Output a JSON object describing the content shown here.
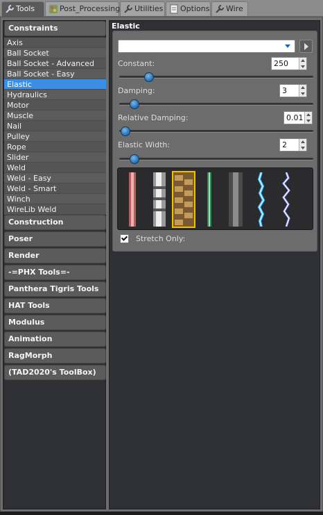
{
  "tabs": [
    {
      "label": "Tools",
      "icon": "wrench-icon",
      "active": true
    },
    {
      "label": "Post_Processing",
      "icon": "palette-icon",
      "active": false
    },
    {
      "label": "Utilities",
      "icon": "wrench-icon",
      "active": false
    },
    {
      "label": "Options",
      "icon": "document-icon",
      "active": false
    },
    {
      "label": "Wire",
      "icon": "wrench-icon",
      "active": false
    }
  ],
  "sidebar": {
    "open_category": "Constraints",
    "items": [
      "Axis",
      "Ball Socket",
      "Ball Socket - Advanced",
      "Ball Socket - Easy",
      "Elastic",
      "Hydraulics",
      "Motor",
      "Muscle",
      "Nail",
      "Pulley",
      "Rope",
      "Slider",
      "Weld",
      "Weld - Easy",
      "Weld - Smart",
      "Winch",
      "WireLib Weld"
    ],
    "selected_item": "Elastic",
    "categories": [
      "Construction",
      "Poser",
      "Render",
      "-=PHX Tools=-",
      "Panthera Tigris Tools",
      "HAT Tools",
      "Modulus",
      "Animation",
      "RagMorph",
      "(TAD2020's ToolBox)"
    ]
  },
  "panel": {
    "title": "Elastic",
    "dropdown_value": "",
    "constant": {
      "label": "Constant:",
      "value": "250",
      "slider_fraction": 0.13
    },
    "damping": {
      "label": "Damping:",
      "value": "3",
      "slider_fraction": 0.05
    },
    "relative_damping": {
      "label": "Relative Damping:",
      "value": "0.01",
      "slider_fraction": 0.0
    },
    "elastic_width": {
      "label": "Elastic Width:",
      "value": "2",
      "slider_fraction": 0.05
    },
    "materials": [
      "red-laser",
      "chrome-spring",
      "rope-braid",
      "green-chain",
      "grey-cable",
      "blue-electric",
      "white-electric"
    ],
    "selected_material": "rope-braid",
    "stretch_only": {
      "label": "Stretch Only:",
      "checked": true
    }
  },
  "colors": {
    "selection": "#3a8ee6",
    "knob": "#2f76b8",
    "material_highlight": "#f2c200"
  }
}
